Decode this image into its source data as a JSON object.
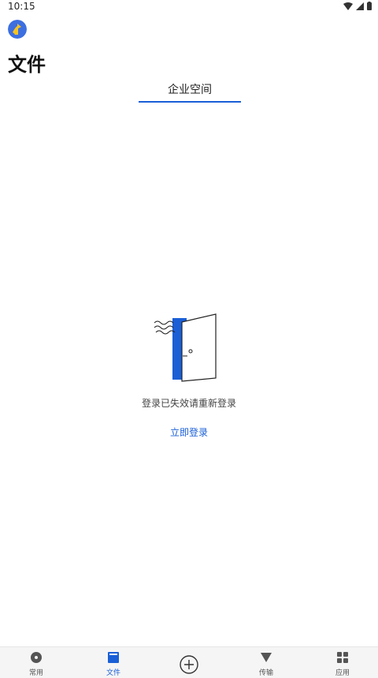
{
  "status_bar": {
    "time": "10:15"
  },
  "header": {
    "title": "文件"
  },
  "tabs": [
    {
      "label": "企业空间",
      "active": true
    }
  ],
  "empty_state": {
    "message": "登录已失效请重新登录",
    "action_label": "立即登录"
  },
  "bottom_nav": {
    "items": [
      {
        "label": "常用",
        "icon": "disc-icon",
        "active": false
      },
      {
        "label": "文件",
        "icon": "file-icon",
        "active": true
      },
      {
        "label": "",
        "icon": "add-circle-icon",
        "active": false
      },
      {
        "label": "传输",
        "icon": "transfer-icon",
        "active": false
      },
      {
        "label": "应用",
        "icon": "apps-grid-icon",
        "active": false
      }
    ]
  },
  "colors": {
    "accent": "#1a5fd6",
    "nav_bg": "#f5f5f5"
  }
}
